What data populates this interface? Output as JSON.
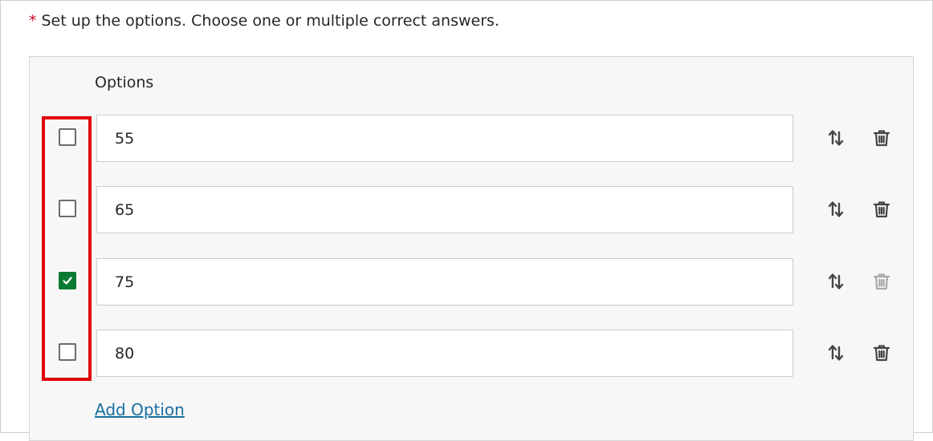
{
  "instruction": {
    "required_marker": "*",
    "text": "Set up the options. Choose one or multiple correct answers."
  },
  "options_panel": {
    "heading": "Options",
    "add_option_label": "Add Option",
    "options": [
      {
        "value": "55",
        "checked": false,
        "delete_enabled": true
      },
      {
        "value": "65",
        "checked": false,
        "delete_enabled": true
      },
      {
        "value": "75",
        "checked": true,
        "delete_enabled": false
      },
      {
        "value": "80",
        "checked": false,
        "delete_enabled": true
      }
    ]
  },
  "colors": {
    "required": "#c8102e",
    "checked": "#0a7a32",
    "highlight": "#e0000b",
    "link": "#1a6fa1",
    "icon": "#444444",
    "icon_disabled": "#a8a8a8"
  },
  "icons": {
    "reorder": "reorder-arrows-icon",
    "delete": "trash-icon",
    "check": "checkmark-icon"
  }
}
